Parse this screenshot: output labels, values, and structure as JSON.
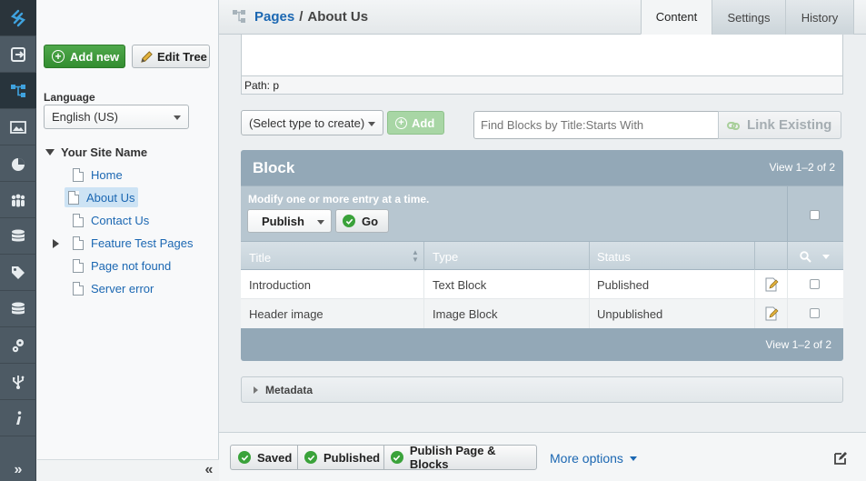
{
  "header": {
    "breadcrumb_root": "Pages",
    "breadcrumb_sep": "/",
    "breadcrumb_current": "About Us",
    "tabs": [
      {
        "label": "Content"
      },
      {
        "label": "Settings"
      },
      {
        "label": "History"
      }
    ]
  },
  "tree": {
    "add_new": "Add new",
    "edit_tree": "Edit Tree",
    "language_label": "Language",
    "language_value": "English (US)",
    "site_name": "Your Site Name",
    "items": [
      {
        "label": "Home"
      },
      {
        "label": "About Us"
      },
      {
        "label": "Contact Us"
      },
      {
        "label": "Feature Test Pages"
      },
      {
        "label": "Page not found"
      },
      {
        "label": "Server error"
      }
    ],
    "collapse_glyph": "«"
  },
  "rail": {
    "expand_glyph": "»"
  },
  "editor": {
    "path_text": "Path: p"
  },
  "blocks": {
    "type_select": "(Select type to create)",
    "add_label": "Add",
    "find_placeholder": "Find Blocks by Title:Starts With",
    "link_existing": "Link Existing",
    "panel_title": "Block",
    "view_count": "View 1–2 of 2",
    "batch_hint": "Modify one or more entry at a time.",
    "batch_action": "Publish",
    "go_label": "Go",
    "columns": {
      "title": "Title",
      "type": "Type",
      "status": "Status"
    },
    "rows": [
      {
        "title": "Introduction",
        "type": "Text Block",
        "status": "Published"
      },
      {
        "title": "Header image",
        "type": "Image Block",
        "status": "Unpublished"
      }
    ],
    "view_count_bottom": "View 1–2 of 2"
  },
  "metadata": {
    "label": "Metadata"
  },
  "footer": {
    "saved": "Saved",
    "published": "Published",
    "publish_all": "Publish Page & Blocks",
    "more_options": "More options"
  },
  "colors": {
    "accent_link": "#1b67b2",
    "green": "#3aa23a",
    "panel_head": "#93a8b7",
    "rail_bg": "#4d5a64"
  }
}
